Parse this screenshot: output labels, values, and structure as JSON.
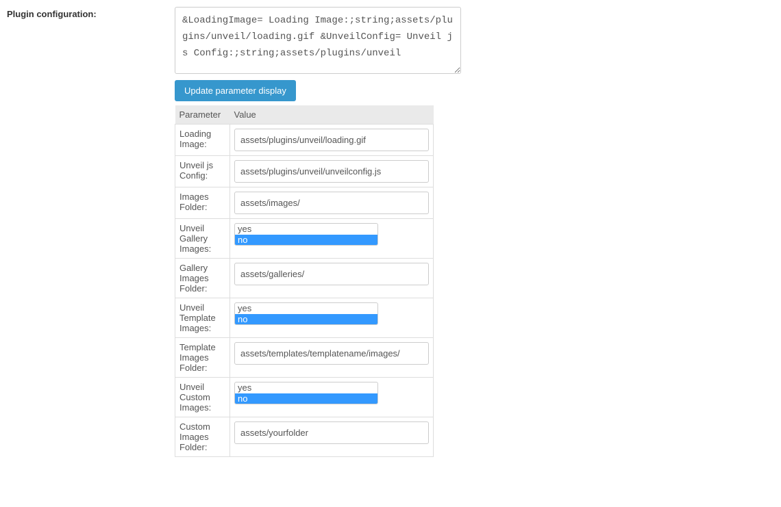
{
  "label": "Plugin configuration:",
  "config_text": "&LoadingImage= Loading Image:;string;assets/plugins/unveil/loading.gif &UnveilConfig= Unveil js Config:;string;assets/plugins/unveil",
  "update_button": "Update parameter display",
  "table": {
    "headers": {
      "param": "Parameter",
      "value": "Value"
    },
    "rows": [
      {
        "label": "Loading Image:",
        "type": "text",
        "value": "assets/plugins/unveil/loading.gif"
      },
      {
        "label": "Unveil js Config:",
        "type": "text",
        "value": "assets/plugins/unveil/unveilconfig.js"
      },
      {
        "label": "Images Folder:",
        "type": "text",
        "value": "assets/images/"
      },
      {
        "label": "Unveil Gallery Images:",
        "type": "select",
        "options": [
          "yes",
          "no"
        ],
        "selected": "no"
      },
      {
        "label": "Gallery Images Folder:",
        "type": "text",
        "value": "assets/galleries/"
      },
      {
        "label": "Unveil Template Images:",
        "type": "select",
        "options": [
          "yes",
          "no"
        ],
        "selected": "no"
      },
      {
        "label": "Template Images Folder:",
        "type": "text",
        "value": "assets/templates/templatename/images/"
      },
      {
        "label": "Unveil Custom Images:",
        "type": "select",
        "options": [
          "yes",
          "no"
        ],
        "selected": "no"
      },
      {
        "label": "Custom Images Folder:",
        "type": "text",
        "value": "assets/yourfolder"
      }
    ]
  }
}
